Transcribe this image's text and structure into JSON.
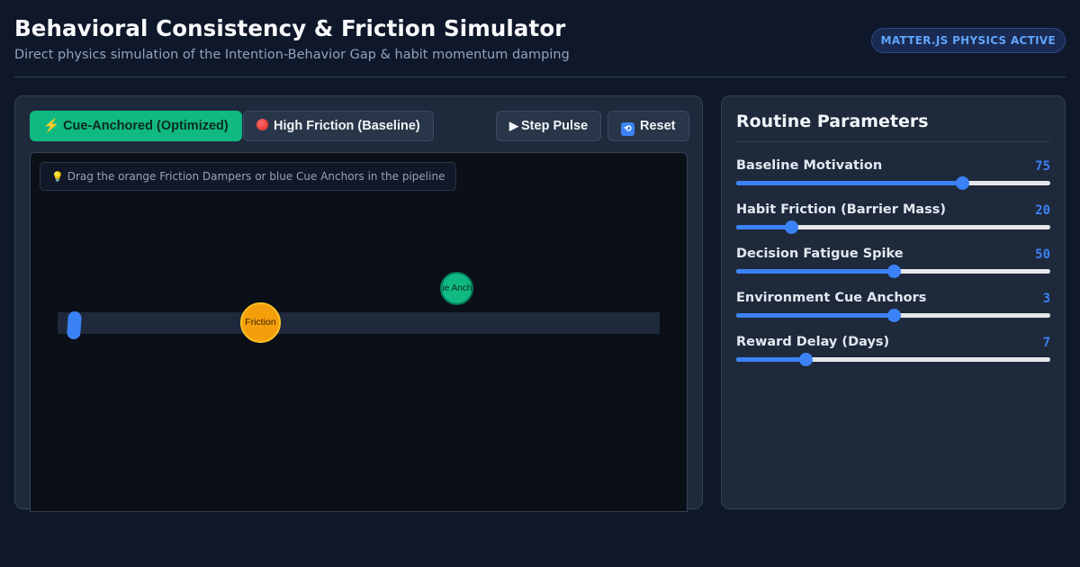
{
  "header": {
    "title": "Behavioral Consistency & Friction Simulator",
    "subtitle": "Direct physics simulation of the Intention-Behavior Gap & habit momentum damping",
    "badge": "MATTER.JS PHYSICS ACTIVE"
  },
  "toolbar": {
    "optimized_label": "Cue-Anchored (Optimized)",
    "baseline_label": "High Friction (Baseline)",
    "step_label": "Step Pulse",
    "reset_label": "Reset"
  },
  "simulation": {
    "hint": "Drag the orange Friction Dampers or blue Cue Anchors in the pipeline",
    "friction_label": "Friction",
    "anchor_label": "Cue Anchor"
  },
  "parameters": {
    "title": "Routine Parameters",
    "items": [
      {
        "label": "Baseline Motivation",
        "value": "75",
        "fraction": 0.72
      },
      {
        "label": "Habit Friction (Barrier Mass)",
        "value": "20",
        "fraction": 0.175
      },
      {
        "label": "Decision Fatigue Spike",
        "value": "50",
        "fraction": 0.5
      },
      {
        "label": "Environment Cue Anchors",
        "value": "3",
        "fraction": 0.5
      },
      {
        "label": "Reward Delay (Days)",
        "value": "7",
        "fraction": 0.22
      }
    ]
  },
  "colors": {
    "accent": "#3b82f6",
    "primary_button": "#10b981",
    "friction": "#f59e0b",
    "anchor": "#10b981",
    "background": "#0f172a"
  }
}
